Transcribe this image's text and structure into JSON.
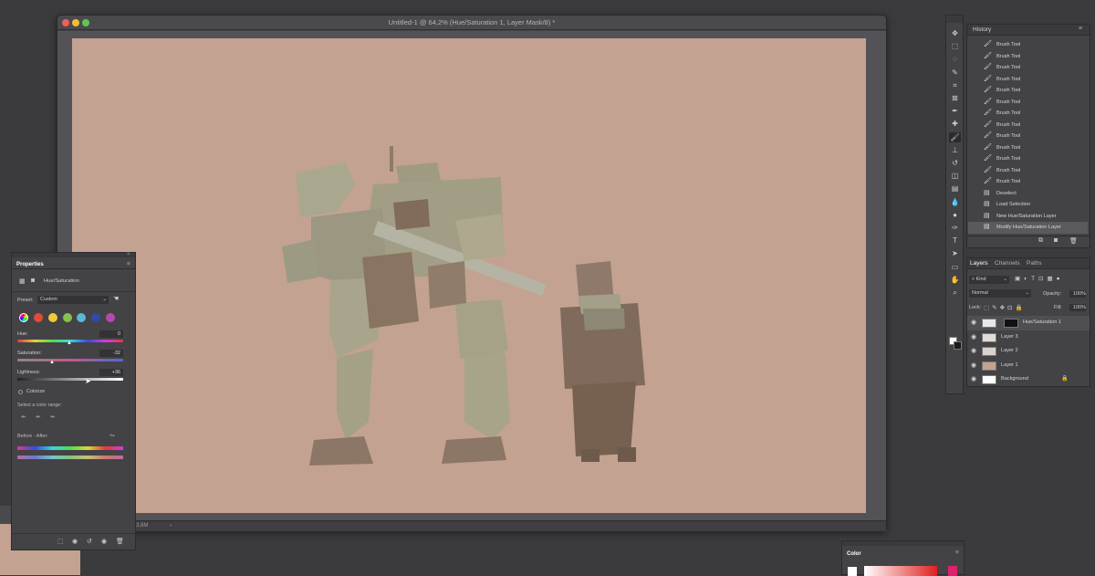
{
  "document": {
    "title": "Untitled-1 @ 64,2% (Hue/Saturation 1, Layer Mask/8) *",
    "status": "3,6M",
    "status_arrow": "›",
    "canvas_color": "#c3a291"
  },
  "tools": {
    "icons": [
      "move-icon",
      "marquee-icon",
      "lasso-icon",
      "quick-select-icon",
      "crop-icon",
      "frame-icon",
      "eyedropper-icon",
      "healing-icon",
      "brush-icon",
      "stamp-icon",
      "history-brush-icon",
      "eraser-icon",
      "gradient-icon",
      "blur-icon",
      "dodge-icon",
      "pen-icon",
      "type-icon",
      "path-select-icon",
      "shape-icon",
      "hand-icon",
      "zoom-icon"
    ],
    "glyphs": [
      "✥",
      "⬚",
      "◌",
      "✎",
      "⌗",
      "⊠",
      "✒",
      "✚",
      "🖌",
      "⊥",
      "↺",
      "◫",
      "▤",
      "💧",
      "●",
      "✑",
      "T",
      "➤",
      "▭",
      "✋",
      "⌕"
    ]
  },
  "history": {
    "tab": "History",
    "items": [
      {
        "label": "Brush Tool",
        "icon": "brush"
      },
      {
        "label": "Brush Tool",
        "icon": "brush"
      },
      {
        "label": "Brush Tool",
        "icon": "brush"
      },
      {
        "label": "Brush Tool",
        "icon": "brush"
      },
      {
        "label": "Brush Tool",
        "icon": "brush"
      },
      {
        "label": "Brush Tool",
        "icon": "brush"
      },
      {
        "label": "Brush Tool",
        "icon": "brush"
      },
      {
        "label": "Brush Tool",
        "icon": "brush"
      },
      {
        "label": "Brush Tool",
        "icon": "brush"
      },
      {
        "label": "Brush Tool",
        "icon": "brush"
      },
      {
        "label": "Brush Tool",
        "icon": "brush"
      },
      {
        "label": "Brush Tool",
        "icon": "brush"
      },
      {
        "label": "Brush Tool",
        "icon": "brush"
      },
      {
        "label": "Deselect",
        "icon": "doc"
      },
      {
        "label": "Load Selection",
        "icon": "doc"
      },
      {
        "label": "New Hue/Saturation Layer",
        "icon": "doc"
      },
      {
        "label": "Modify Hue/Saturation Layer",
        "icon": "doc"
      }
    ]
  },
  "layers": {
    "tabs": [
      "Layers",
      "Channels",
      "Paths"
    ],
    "filter": "Kind",
    "blend_mode": "Normal",
    "opacity_label": "Opacity:",
    "opacity": "100%",
    "lock_label": "Lock:",
    "fill_label": "Fill:",
    "fill": "100%",
    "items": [
      {
        "name": "Hue/Saturation 1",
        "thumb": "#e8e8e8"
      },
      {
        "name": "Layer 3",
        "thumb": "#e0dcda"
      },
      {
        "name": "Layer 2",
        "thumb": "#d9d2cd"
      },
      {
        "name": "Layer 1",
        "thumb": "#c3a291"
      },
      {
        "name": "Background",
        "thumb": "#ffffff"
      }
    ]
  },
  "properties": {
    "title": "Properties",
    "adjustment": "Hue/Saturation",
    "preset_label": "Preset:",
    "preset_value": "Custom",
    "hue_label": "Hue:",
    "hue_value": "0",
    "saturation_label": "Saturation:",
    "saturation_value": "-32",
    "lightness_label": "Lightness:",
    "lightness_value": "+36",
    "colorize_label": "Colorize",
    "range_label": "Select a color range:",
    "before_after_label": "Before - After:",
    "swatches": [
      "#e24a3a",
      "#f0c93a",
      "#88c24a",
      "#5ab7d6",
      "#2f4aa8",
      "#b44ab0"
    ]
  },
  "color_panel": {
    "title": "Color"
  }
}
